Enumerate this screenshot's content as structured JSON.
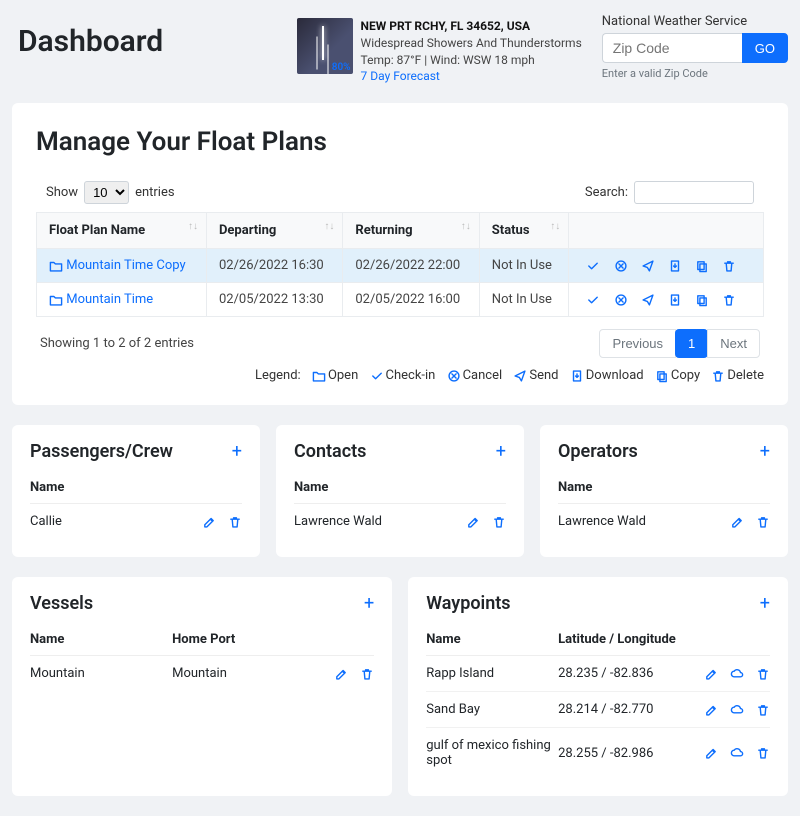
{
  "page_title": "Dashboard",
  "weather": {
    "location": "NEW PRT RCHY, FL 34652, USA",
    "desc": "Widespread Showers And Thunderstorms",
    "detail": "Temp: 87°F | Wind: WSW 18 mph",
    "forecast_link": "7 Day Forecast",
    "pct": "80%"
  },
  "nws": {
    "label": "National Weather Service",
    "placeholder": "Zip Code",
    "go": "GO",
    "hint": "Enter a valid Zip Code"
  },
  "manage": {
    "title": "Manage Your Float Plans",
    "show": "Show",
    "entries": "entries",
    "entries_value": "10",
    "search_label": "Search:",
    "cols": {
      "name": "Float Plan Name",
      "depart": "Departing",
      "return": "Returning",
      "status": "Status"
    },
    "rows": [
      {
        "name": "Mountain Time Copy",
        "depart": "02/26/2022 16:30",
        "return": "02/26/2022 22:00",
        "status": "Not In Use"
      },
      {
        "name": "Mountain Time",
        "depart": "02/05/2022 13:30",
        "return": "02/05/2022 16:00",
        "status": "Not In Use"
      }
    ],
    "footer_info": "Showing 1 to 2 of 2 entries",
    "pager": {
      "prev": "Previous",
      "page": "1",
      "next": "Next"
    },
    "legend": {
      "label": "Legend:",
      "open": "Open",
      "checkin": "Check-in",
      "cancel": "Cancel",
      "send": "Send",
      "download": "Download",
      "copy": "Copy",
      "delete": "Delete"
    }
  },
  "cards": {
    "passengers": {
      "title": "Passengers/Crew",
      "col_name": "Name",
      "rows": [
        {
          "name": "Callie"
        }
      ]
    },
    "contacts": {
      "title": "Contacts",
      "col_name": "Name",
      "rows": [
        {
          "name": "Lawrence Wald"
        }
      ]
    },
    "operators": {
      "title": "Operators",
      "col_name": "Name",
      "rows": [
        {
          "name": "Lawrence Wald"
        }
      ]
    },
    "vessels": {
      "title": "Vessels",
      "col_name": "Name",
      "col_port": "Home Port",
      "rows": [
        {
          "name": "Mountain",
          "port": "Mountain"
        }
      ]
    },
    "waypoints": {
      "title": "Waypoints",
      "col_name": "Name",
      "col_loc": "Latitude / Longitude",
      "rows": [
        {
          "name": "Rapp Island",
          "loc": "28.235 / -82.836"
        },
        {
          "name": "Sand Bay",
          "loc": "28.214 / -82.770"
        },
        {
          "name": "gulf of mexico fishing spot",
          "loc": "28.255 / -82.986"
        }
      ]
    }
  }
}
